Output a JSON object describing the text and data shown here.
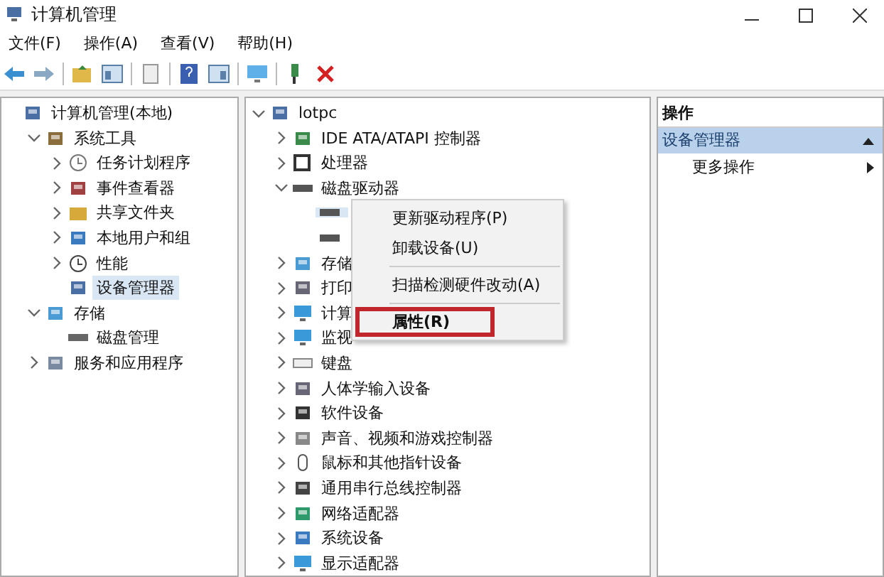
{
  "window": {
    "title": "计算机管理"
  },
  "menu": [
    "文件(F)",
    "操作(A)",
    "查看(V)",
    "帮助(H)"
  ],
  "left_tree": [
    {
      "label": "计算机管理(本地)",
      "kind": "computer",
      "selected": false,
      "children": [
        {
          "label": "系统工具",
          "kind": "tools",
          "expanded": true,
          "selected": false,
          "children": [
            {
              "label": "任务计划程序",
              "kind": "clock",
              "expanded": false,
              "selected": false
            },
            {
              "label": "事件查看器",
              "kind": "viewer",
              "expanded": false,
              "selected": false
            },
            {
              "label": "共享文件夹",
              "kind": "folder",
              "expanded": false,
              "selected": false
            },
            {
              "label": "本地用户和组",
              "kind": "users",
              "expanded": false,
              "selected": false
            },
            {
              "label": "性能",
              "kind": "perf",
              "expanded": false,
              "selected": false
            },
            {
              "label": "设备管理器",
              "kind": "computer",
              "selected": true
            }
          ]
        },
        {
          "label": "存储",
          "kind": "storage",
          "expanded": true,
          "selected": false,
          "children": [
            {
              "label": "磁盘管理",
              "kind": "disk",
              "selected": false
            }
          ]
        },
        {
          "label": "服务和应用程序",
          "kind": "services",
          "expanded": false,
          "selected": false
        }
      ]
    }
  ],
  "device_tree": [
    {
      "label": "lotpc",
      "kind": "computer",
      "expanded": true,
      "selected": false,
      "children": [
        {
          "label": "IDE ATA/ATAPI 控制器",
          "kind": "ide",
          "expanded": false,
          "selected": false
        },
        {
          "label": "处理器",
          "kind": "cpu",
          "expanded": false,
          "selected": false
        },
        {
          "label": "磁盘驱动器",
          "kind": "drive",
          "expanded": true,
          "selected": false,
          "children": [
            {
              "kind": "drive",
              "selected": true
            },
            {
              "kind": "drive",
              "selected": false
            }
          ]
        },
        {
          "label": "存储",
          "kind": "storage",
          "expanded": false,
          "selected": false
        },
        {
          "label": "打印",
          "kind": "printer",
          "expanded": false,
          "selected": false
        },
        {
          "label": "计算",
          "kind": "monitor",
          "expanded": false,
          "selected": false
        },
        {
          "label": "监视",
          "kind": "monitor",
          "expanded": false,
          "selected": false
        },
        {
          "label": "键盘",
          "kind": "keyboard",
          "expanded": false,
          "selected": false
        },
        {
          "label": "人体学输入设备",
          "kind": "hid",
          "expanded": false,
          "selected": false
        },
        {
          "label": "软件设备",
          "kind": "software",
          "expanded": false,
          "selected": false
        },
        {
          "label": "声音、视频和游戏控制器",
          "kind": "sound",
          "expanded": false,
          "selected": false
        },
        {
          "label": "鼠标和其他指针设备",
          "kind": "mouse",
          "expanded": false,
          "selected": false
        },
        {
          "label": "通用串行总线控制器",
          "kind": "usb",
          "expanded": false,
          "selected": false
        },
        {
          "label": "网络适配器",
          "kind": "network",
          "expanded": false,
          "selected": false
        },
        {
          "label": "系统设备",
          "kind": "system",
          "expanded": false,
          "selected": false
        },
        {
          "label": "显示适配器",
          "kind": "monitor",
          "expanded": false,
          "selected": false
        }
      ]
    }
  ],
  "context_menu": [
    {
      "kind": "item",
      "label": "更新驱动程序(P)",
      "highlighted": false
    },
    {
      "kind": "item",
      "label": "卸载设备(U)",
      "highlighted": false
    },
    {
      "kind": "separator"
    },
    {
      "kind": "item",
      "label": "扫描检测硬件改动(A)",
      "highlighted": false
    },
    {
      "kind": "separator"
    },
    {
      "kind": "item",
      "label": "属性(R)",
      "highlighted": true
    }
  ],
  "actions": {
    "header": "操作",
    "section": {
      "label": "设备管理器",
      "expanded": true
    },
    "items": [
      "更多操作"
    ]
  }
}
